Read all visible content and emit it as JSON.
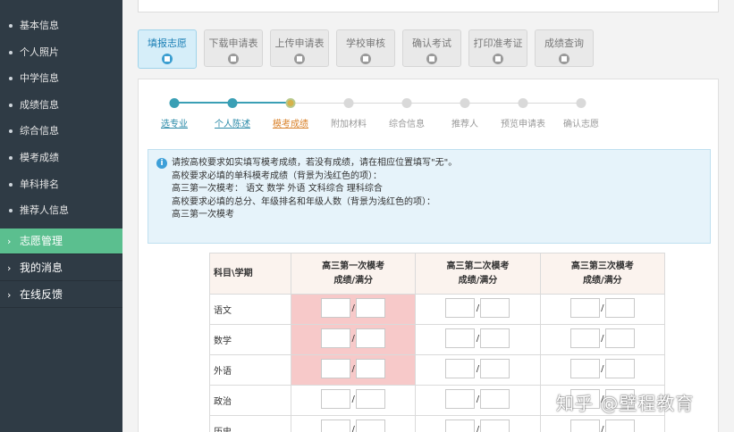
{
  "sidebar": {
    "sub_items": [
      "基本信息",
      "个人照片",
      "中学信息",
      "成绩信息",
      "综合信息",
      "模考成绩",
      "单科排名",
      "推荐人信息"
    ],
    "main_items": [
      {
        "label": "志愿管理",
        "active": true
      },
      {
        "label": "我的消息",
        "active": false
      },
      {
        "label": "在线反馈",
        "active": false
      }
    ]
  },
  "steps": [
    {
      "label": "填报志愿",
      "active": true
    },
    {
      "label": "下载申请表",
      "active": false
    },
    {
      "label": "上传申请表",
      "active": false
    },
    {
      "label": "学校审核",
      "active": false
    },
    {
      "label": "确认考试",
      "active": false
    },
    {
      "label": "打印准考证",
      "active": false
    },
    {
      "label": "成绩查询",
      "active": false
    }
  ],
  "progress": [
    {
      "label": "选专业",
      "state": "done"
    },
    {
      "label": "个人陈述",
      "state": "done"
    },
    {
      "label": "模考成绩",
      "state": "current"
    },
    {
      "label": "附加材料",
      "state": "todo"
    },
    {
      "label": "综合信息",
      "state": "todo"
    },
    {
      "label": "推荐人",
      "state": "todo"
    },
    {
      "label": "预览申请表",
      "state": "todo"
    },
    {
      "label": "确认志愿",
      "state": "todo"
    }
  ],
  "notice": {
    "icon": "i",
    "lines": [
      "请按高校要求如实填写模考成绩，若没有成绩，请在相应位置填写\"无\"。",
      "高校要求必填的单科模考成绩（背景为浅红色的项）：",
      "高三第一次模考： 语文 数学 外语 文科综合 理科综合",
      "高校要求必填的总分、年级排名和年级人数（背景为浅红色的项）：",
      "高三第一次模考"
    ]
  },
  "table": {
    "corner": "科目\\学期",
    "headers": [
      {
        "line1": "高三第一次模考",
        "line2": "成绩/满分"
      },
      {
        "line1": "高三第二次模考",
        "line2": "成绩/满分"
      },
      {
        "line1": "高三第三次模考",
        "line2": "成绩/满分"
      }
    ],
    "rows": [
      {
        "subject": "语文",
        "required": true
      },
      {
        "subject": "数学",
        "required": true
      },
      {
        "subject": "外语",
        "required": true
      },
      {
        "subject": "政治",
        "required": false
      },
      {
        "subject": "历史",
        "required": false
      }
    ],
    "slash": "/"
  },
  "watermark": "知乎 @壁程教育",
  "colors": {
    "sidebar_bg": "#2f3b45",
    "sidebar_active": "#5bbf8f",
    "required_cell": "#f7c9c9",
    "progress_done": "#3a9fb5",
    "progress_current": "#d9822b"
  }
}
